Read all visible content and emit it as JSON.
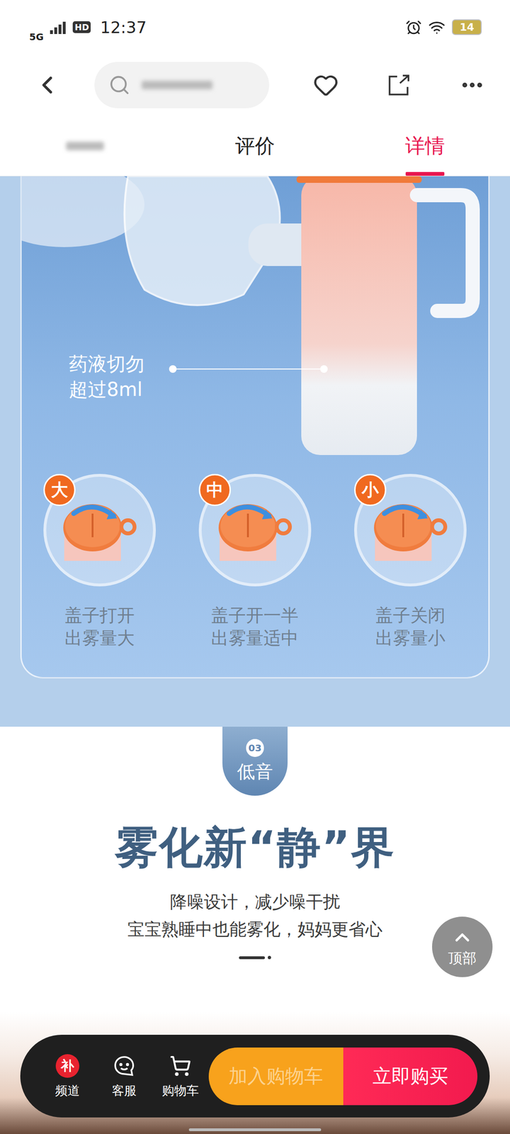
{
  "status_bar": {
    "network": "5G",
    "hd": "HD",
    "time": "12:37",
    "battery": "14"
  },
  "tabs": [
    {
      "label": "",
      "kind": "blurred",
      "selected": false
    },
    {
      "label": "评价",
      "kind": "text",
      "selected": false
    },
    {
      "label": "详情",
      "kind": "text",
      "selected": true
    }
  ],
  "detail": {
    "volume_note": [
      "药液切勿",
      "超过8ml"
    ],
    "modes": [
      {
        "badge": "大",
        "caption": [
          "盖子打开",
          "出雾量大"
        ]
      },
      {
        "badge": "中",
        "caption": [
          "盖子开一半",
          "出雾量适中"
        ]
      },
      {
        "badge": "小",
        "caption": [
          "盖子关闭",
          "出雾量小"
        ]
      }
    ]
  },
  "section": {
    "number": "03",
    "tag": "低音",
    "title": "雾化新“静”界",
    "subtitle": [
      "降噪设计，减少噪干扰",
      "宝宝熟睡中也能雾化，妈妈更省心"
    ]
  },
  "back_to_top": "顶部",
  "bottom_bar": {
    "items": [
      {
        "label": "频道",
        "badge": "补"
      },
      {
        "label": "客服",
        "badge": ""
      },
      {
        "label": "购物车",
        "badge": ""
      }
    ],
    "add_to_cart": "加入购物车",
    "buy_now": "立即购买"
  }
}
